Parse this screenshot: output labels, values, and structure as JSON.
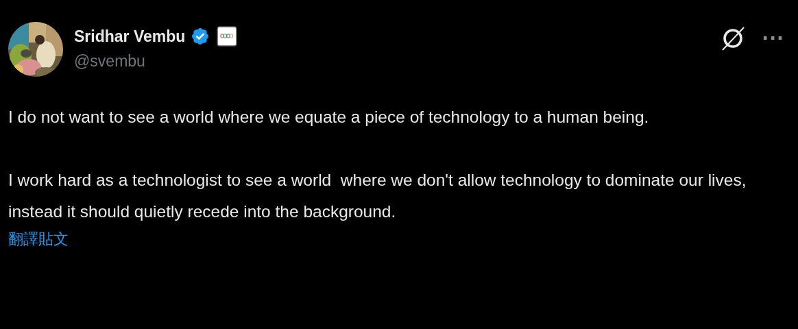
{
  "author": {
    "name": "Sridhar Vembu",
    "verified": true,
    "handle": "@svembu"
  },
  "actions": {
    "more": "···"
  },
  "paragraphs": [
    "I do not want to see a world where we equate a piece of technology to a human being.",
    "I work hard as a technologist to see a world  where we don't allow technology to dominate our lives, instead it should quietly recede into the background."
  ],
  "translate_link": "翻譯貼文"
}
